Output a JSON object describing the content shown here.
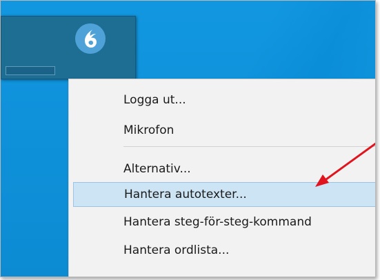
{
  "menu": {
    "items": [
      {
        "label": "Logga ut..."
      },
      {
        "label": "Mikrofon"
      },
      {
        "label": "Alternativ..."
      },
      {
        "label": "Hantera autotexter..."
      },
      {
        "label": "Hantera steg-för-steg-kommand"
      },
      {
        "label": "Hantera ordlista..."
      }
    ],
    "highlighted_index": 3
  },
  "icons": {
    "logo": "dragon-logo-icon"
  },
  "colors": {
    "desktop": "#0f91d8",
    "dragon_bar": "#1e6d92",
    "menu_background": "#f2f2f2",
    "highlight": "#cde4f4",
    "annotation_arrow": "#e0141e"
  }
}
